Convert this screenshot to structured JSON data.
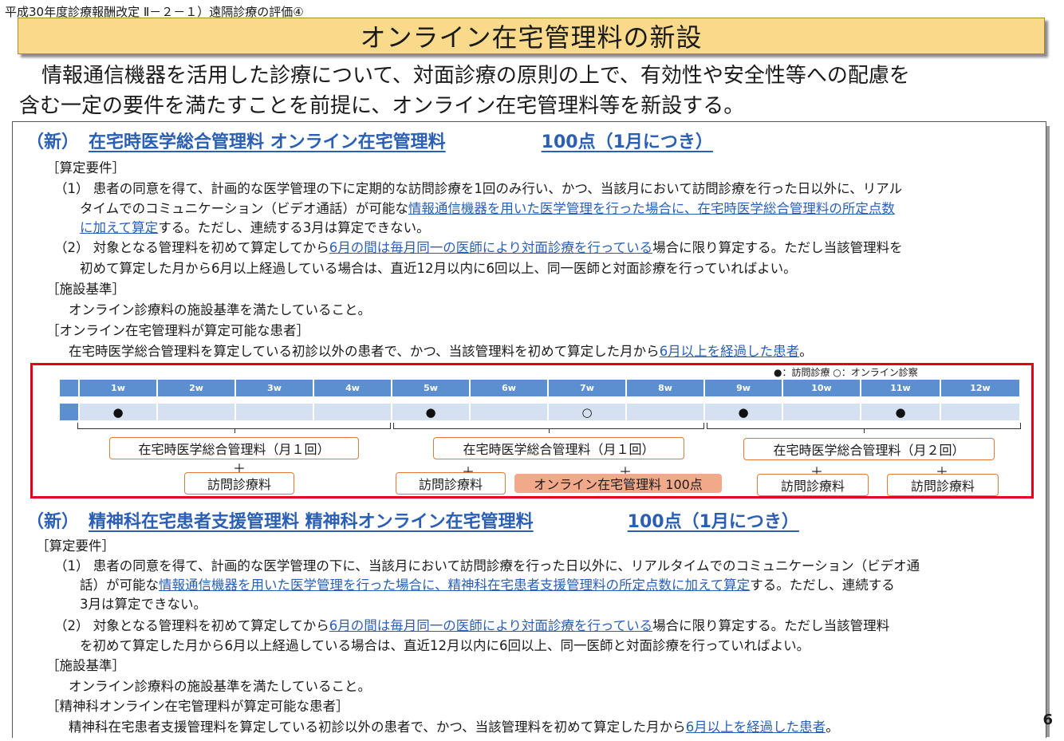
{
  "header_ref": "平成30年度診療報酬改定 Ⅱ－２－１）遠隔診療の評価④",
  "title": "オンライン在宅管理料の新設",
  "intro": [
    "情報通信機器を活用した診療について、対面診療の原則の上で、有効性や安全性等への配慮を",
    "含む一定の要件を満たすことを前提に、オンライン在宅管理料等を新設する。"
  ],
  "section1": {
    "label": "（新）",
    "name": "在宅時医学総合管理料 オンライン在宅管理料",
    "points": "100点（1月につき）",
    "req_head": "［算定要件］",
    "req1_a": "（1） 患者の同意を得て、計画的な医学管理の下に定期的な訪問診療を1回のみ行い、かつ、当該月において訪問診療を行った日以外に、リアル",
    "req1_b_plain": "タイムでのコミュニケーション（ビデオ通話）が可能な",
    "req1_b_link": "情報通信機器を用いた医学管理を行った場合に、在宅時医学総合管理料の所定点数",
    "req1_c_link": "に加えて算定",
    "req1_c_plain": "する。ただし、連続する3月は算定できない。",
    "req2_a_plain": "（2） 対象となる管理料を初めて算定してから",
    "req2_a_link": "6月の間は毎月同一の医師により対面診療を行っている",
    "req2_a_tail": "場合に限り算定する。ただし当該管理料を",
    "req2_b": "初めて算定した月から6月以上経過している場合は、直近12月以内に6回以上、同一医師と対面診療を行っていればよい。",
    "fac_head": "［施設基準］",
    "fac": "オンライン診療料の施設基準を満たしていること。",
    "pat_head": "［オンライン在宅管理料が算定可能な患者］",
    "pat_plain": "在宅時医学総合管理料を算定している初診以外の患者で、かつ、当該管理料を初めて算定した月から",
    "pat_link": "6月以上を経過した患者",
    "pat_tail": "。"
  },
  "timeline": {
    "legend": "●：訪問診療 ○：オンライン診察",
    "weeks": [
      "1w",
      "2w",
      "3w",
      "4w",
      "5w",
      "6w",
      "7w",
      "8w",
      "9w",
      "10w",
      "11w",
      "12w"
    ],
    "marks": [
      "●",
      "",
      "",
      "",
      "●",
      "",
      "○",
      "",
      "●",
      "",
      "●",
      ""
    ],
    "month_boxes": [
      "在宅時医学総合管理料（月１回）",
      "在宅時医学総合管理料（月１回）",
      "在宅時医学総合管理料（月２回）"
    ],
    "plus": "＋",
    "visit": "訪問診療料",
    "online_fee": "オンライン在宅管理料 100点"
  },
  "section2": {
    "label": "（新）",
    "name": "精神科在宅患者支援管理料 精神科オンライン在宅管理料",
    "points": "100点（1月につき）",
    "req_head": "［算定要件］",
    "req1_a": "（1） 患者の同意を得て、計画的な医学管理の下に、当該月において訪問診療を行った日以外に、リアルタイムでのコミュニケーション（ビデオ通",
    "req1_b_plain": "話）が可能な",
    "req1_b_link": "情報通信機器を用いた医学管理を行った場合に、精神科在宅患者支援管理料の所定点数に加えて算定",
    "req1_b_tail": "する。ただし、連続する",
    "req1_c": "3月は算定できない。",
    "req2_a_plain": "（2） 対象となる管理料を初めて算定してから",
    "req2_a_link": "6月の間は毎月同一の医師により対面診療を行っている",
    "req2_a_tail": "場合に限り算定する。ただし当該管理料",
    "req2_b": "を初めて算定した月から6月以上経過している場合は、直近12月以内に6回以上、同一医師と対面診療を行っていればよい。",
    "fac_head": "［施設基準］",
    "fac": "オンライン診療料の施設基準を満たしていること。",
    "pat_head": "［精神科オンライン在宅管理料が算定可能な患者］",
    "pat_plain": "精神科在宅患者支援管理料を算定している初診以外の患者で、かつ、当該管理料を初めて算定した月から",
    "pat_link": "6月以上を経過した患者",
    "pat_tail": "。"
  },
  "page_number": "6"
}
